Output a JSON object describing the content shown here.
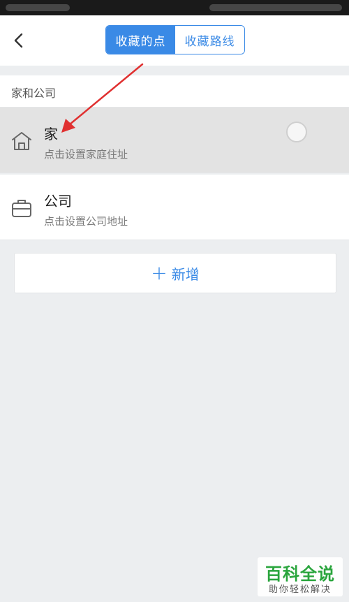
{
  "header": {
    "tabs": [
      {
        "label": "收藏的点",
        "active": true
      },
      {
        "label": "收藏路线",
        "active": false
      }
    ]
  },
  "section": {
    "title": "家和公司"
  },
  "places": [
    {
      "name": "家",
      "hint": "点击设置家庭住址",
      "icon": "home-icon",
      "selected": false
    },
    {
      "name": "公司",
      "hint": "点击设置公司地址",
      "icon": "briefcase-icon"
    }
  ],
  "add_button": {
    "plus": "+",
    "label": "新增"
  },
  "watermark": {
    "title": "百科全说",
    "subtitle": "助你轻松解决"
  },
  "colors": {
    "accent": "#3a8ae6",
    "annotation": "#e03030",
    "watermark": "#2aa53d"
  }
}
